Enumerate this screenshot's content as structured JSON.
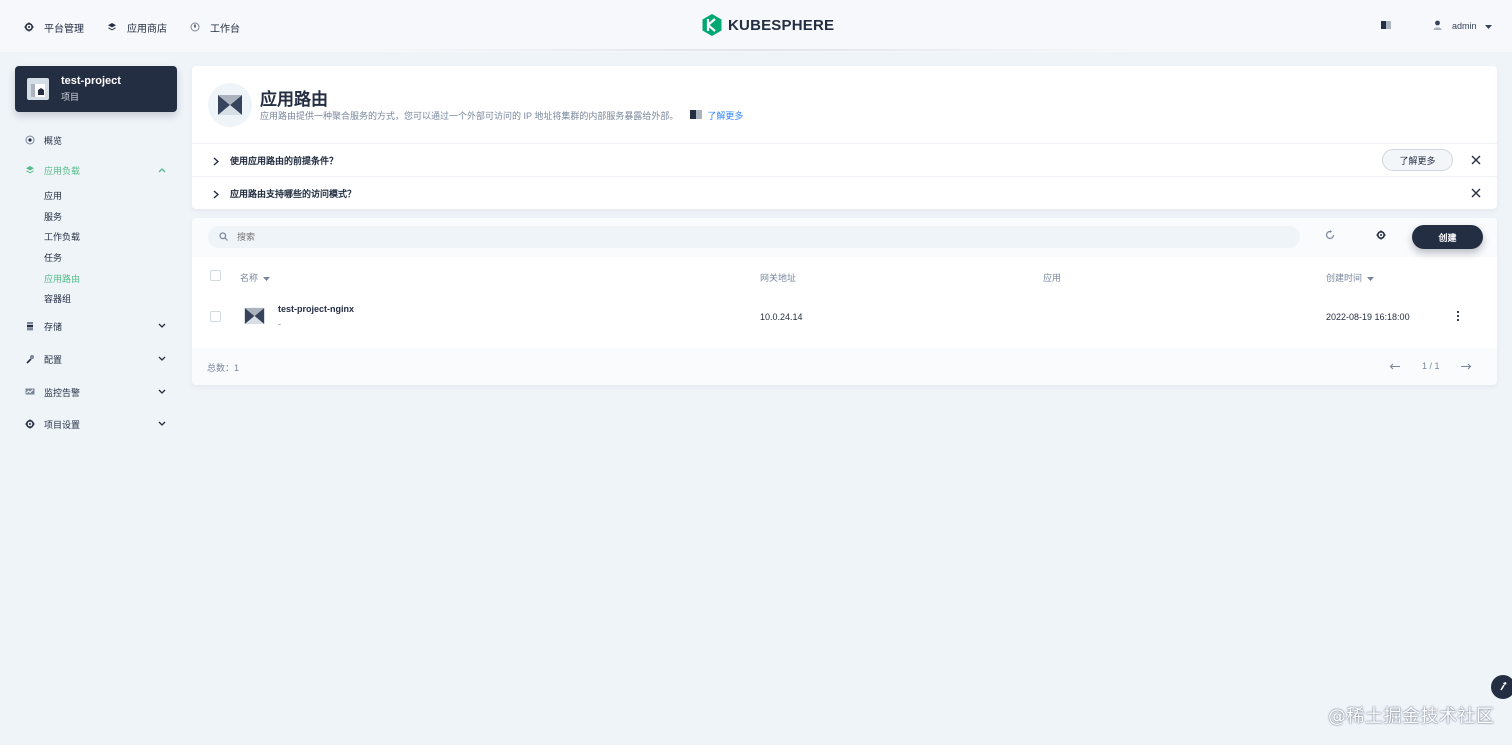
{
  "topnav": {
    "items": [
      {
        "label": "平台管理",
        "icon": "gear-icon"
      },
      {
        "label": "应用商店",
        "icon": "appstore-icon"
      },
      {
        "label": "工作台",
        "icon": "dashboard-icon"
      }
    ],
    "logo": "KUBESPHERE",
    "user": "admin"
  },
  "project": {
    "name": "test-project",
    "type": "项目"
  },
  "sidebar": {
    "overview": "概览",
    "workloads": "应用负载",
    "sub_items": [
      "应用",
      "服务",
      "工作负载",
      "任务",
      "应用路由",
      "容器组"
    ],
    "storage": "存储",
    "config": "配置",
    "monitoring": "监控告警",
    "settings": "项目设置"
  },
  "banner": {
    "title": "应用路由",
    "description": "应用路由提供一种聚合服务的方式，您可以通过一个外部可访问的 IP 地址将集群的内部服务暴露给外部。",
    "learn_more": "了解更多",
    "tips": [
      {
        "text": "使用应用路由的前提条件？",
        "button": "了解更多"
      },
      {
        "text": "应用路由支持哪些的访问模式？"
      }
    ]
  },
  "toolbar": {
    "search_placeholder": "搜索",
    "create_label": "创建"
  },
  "table": {
    "columns": [
      "名称",
      "网关地址",
      "应用",
      "创建时间"
    ],
    "rows": [
      {
        "name": "test-project-nginx",
        "sub": "-",
        "gateway": "10.0.24.14",
        "app": "",
        "created": "2022-08-19 16:18:00"
      }
    ],
    "total": "总数：1",
    "page": "1 / 1"
  },
  "watermark": "@稀土掘金技术社区",
  "colors": {
    "accent": "#55bc8a",
    "dark": "#242e42",
    "link": "#3385ff",
    "background": "#eff4f9"
  }
}
